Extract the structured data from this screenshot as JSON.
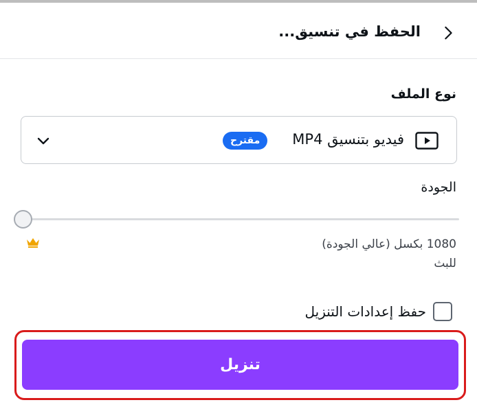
{
  "header": {
    "title": "الحفظ في تنسيق...",
    "back_icon": "chevron-right-icon"
  },
  "file_type": {
    "label": "نوع الملف",
    "selected_value": "فيديو بتنسيق MP4",
    "badge": "مقترح",
    "icon": "video-play-icon",
    "dropdown_icon": "chevron-down-icon"
  },
  "quality": {
    "label": "الجودة",
    "level": 0,
    "value_line1": "1080 بكسل (عالي الجودة)",
    "value_line2": "للبث",
    "premium_icon": "crown-icon"
  },
  "save_settings": {
    "label": "حفظ إعدادات التنزيل",
    "checked": false
  },
  "download": {
    "label": "تنزيل"
  },
  "colors": {
    "accent": "#8b3dff",
    "badge": "#1a6cf2",
    "crown": "#f0a500",
    "highlight_border": "#d91b1b"
  }
}
